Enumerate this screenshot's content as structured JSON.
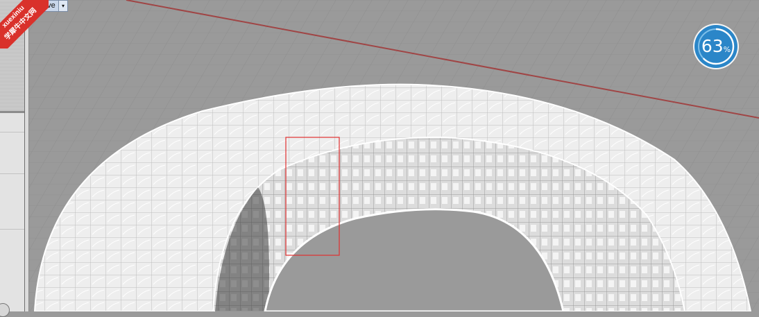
{
  "viewport": {
    "view_label": "...ve",
    "dropdown_arrow": "▾"
  },
  "watermark": {
    "line1": "xuexiniu",
    "line2": "学犀牛中文网"
  },
  "progress": {
    "value": 63,
    "unit": "%",
    "fraction": 0.63
  },
  "colors": {
    "viewport_bg": "#9a9a9a",
    "grid": "#8c8c8c",
    "axis_red": "#a04545",
    "mesh_white": "#f5f5f5",
    "selection_box": "#e03030",
    "progress_blue": "#2b86c8",
    "watermark_red": "#d9312b"
  }
}
